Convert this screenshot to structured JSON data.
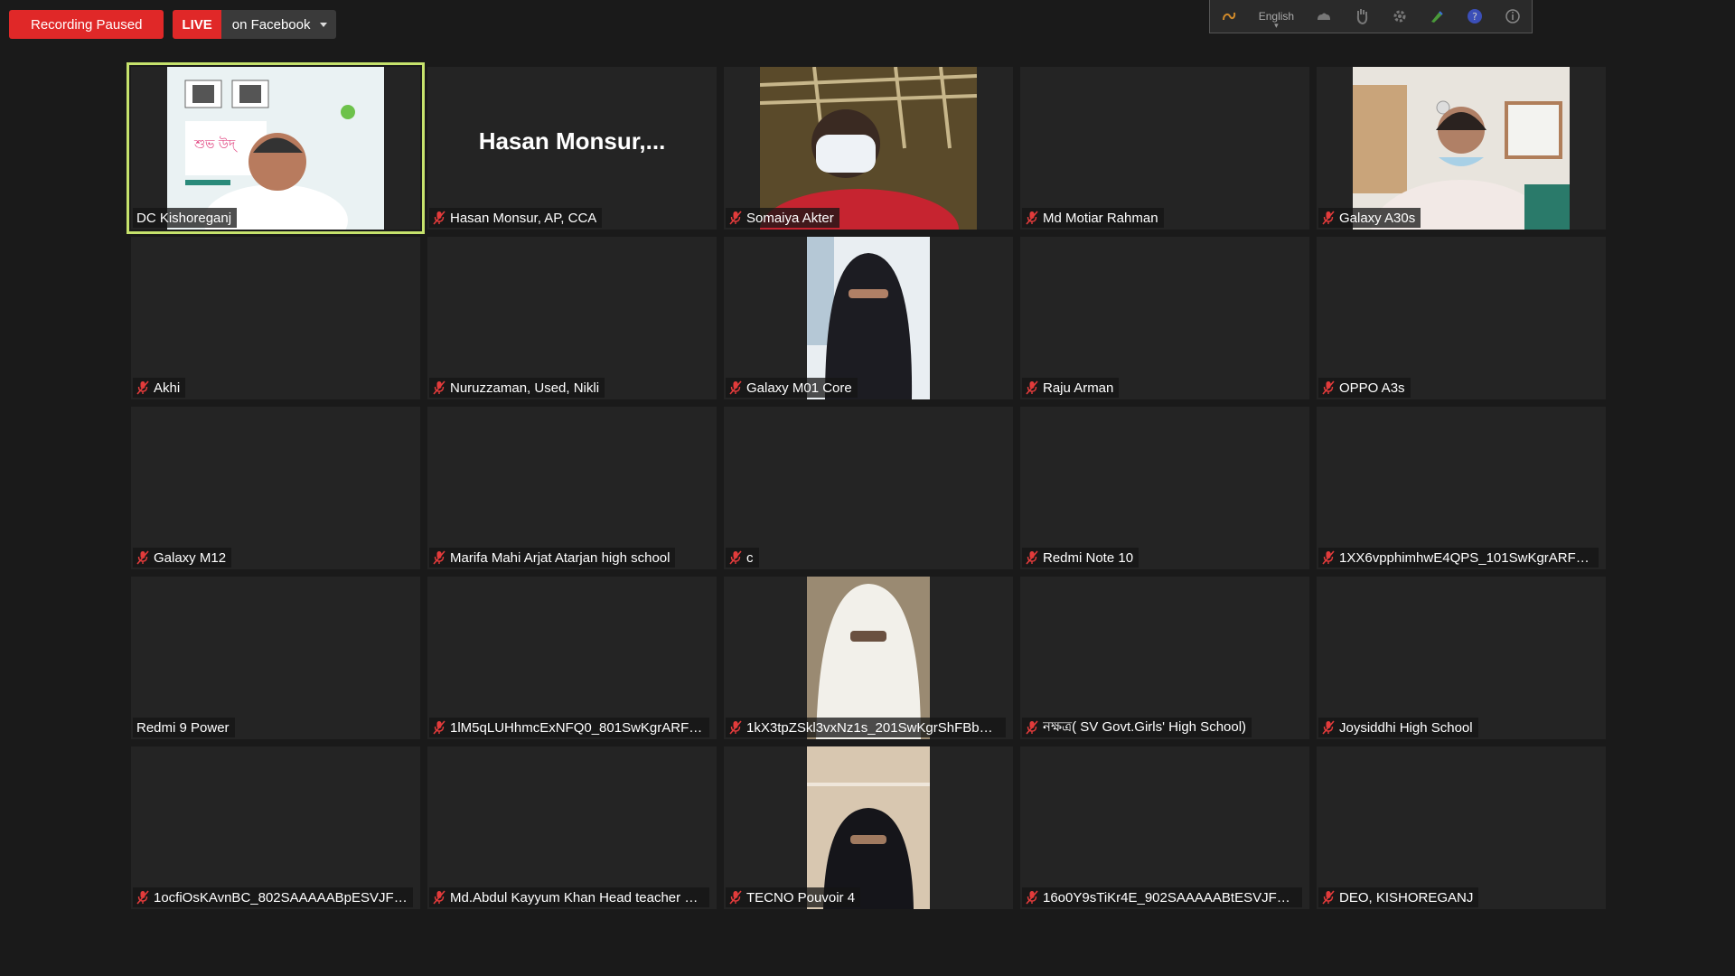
{
  "topbar": {
    "recording_label": "Recording Paused",
    "live_label": "LIVE",
    "live_target": "on Facebook"
  },
  "floating_toolbar": {
    "language": "English"
  },
  "colors": {
    "active_border": "#c6e26c",
    "muted_icon": "#e23b3b",
    "live_red": "#e02828"
  },
  "tiles": [
    {
      "name": "DC Kishoreganj",
      "muted": false,
      "active": true,
      "video": "presenter"
    },
    {
      "name": "Hasan Monsur, AP, CCA",
      "muted": true,
      "big_name": "Hasan  Monsur,..."
    },
    {
      "name": "Somaiya Akter",
      "muted": true,
      "video": "masked"
    },
    {
      "name": "Md Motiar Rahman",
      "muted": true
    },
    {
      "name": "Galaxy A30s",
      "muted": true,
      "video": "classroom"
    },
    {
      "name": "Akhi",
      "muted": true
    },
    {
      "name": "Nuruzzaman, Used, Nikli",
      "muted": true
    },
    {
      "name": "Galaxy M01 Core",
      "muted": true,
      "video": "niqab-black"
    },
    {
      "name": "Raju Arman",
      "muted": true
    },
    {
      "name": "OPPO A3s",
      "muted": true
    },
    {
      "name": "Galaxy M12",
      "muted": true
    },
    {
      "name": "Marifa Mahi Arjat Atarjan high school",
      "muted": true
    },
    {
      "name": "c",
      "muted": true
    },
    {
      "name": "Redmi Note 10",
      "muted": true
    },
    {
      "name": "1XX6vpphimhwE4QPS_101SwKgrARFB...",
      "muted": true
    },
    {
      "name": "Redmi 9 Power",
      "muted": false
    },
    {
      "name": "1lM5qLUHhmcExNFQ0_801SwKgrARFB...",
      "muted": true
    },
    {
      "name": "1kX3tpZSkl3vxNz1s_201SwKgrShFBbm...",
      "muted": true,
      "video": "niqab-white"
    },
    {
      "name": "নক্ষত্র( SV Govt.Girls' High School)",
      "muted": true
    },
    {
      "name": "Joysiddhi High School",
      "muted": true
    },
    {
      "name": "1ocfiOsKAvnBC_802SAAAAABpESVJFQ...",
      "muted": true
    },
    {
      "name": "Md.Abdul Kayyum Khan Head teacher H...",
      "muted": true
    },
    {
      "name": "TECNO Pouvoir 4",
      "muted": true,
      "video": "niqab-black2"
    },
    {
      "name": "16o0Y9sTiKr4E_902SAAAAABtESVJFQ1...",
      "muted": true
    },
    {
      "name": "DEO, KISHOREGANJ",
      "muted": true
    }
  ]
}
